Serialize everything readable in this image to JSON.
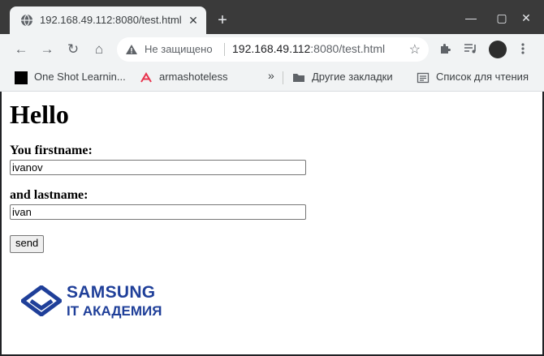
{
  "browser": {
    "tab": {
      "title": "192.168.49.112:8080/test.html",
      "favicon": "globe-icon",
      "close": "✕"
    },
    "new_tab": "+",
    "window_controls": [
      "—",
      "▢",
      "✕"
    ],
    "nav": {
      "back": "←",
      "forward": "→",
      "reload": "↻",
      "home": "⌂"
    },
    "omnibox": {
      "security_label": "Не защищено",
      "url_host": "192.168.49.112",
      "url_rest": ":8080/test.html"
    },
    "bookmarks": [
      {
        "label": "One Shot Learnin...",
        "icon": "black-square-icon"
      },
      {
        "label": "armashoteless",
        "icon": "red-arrow-icon"
      }
    ],
    "bookmarks_overflow": "»",
    "other_bookmarks": "Другие закладки",
    "reading_list": "Список для чтения",
    "colors": {
      "titlebar": "#3a3a3a",
      "toolbar": "#f1f3f4",
      "logo_blue": "#1f3f99"
    }
  },
  "page": {
    "heading": "Hello",
    "form": {
      "firstname_label": "You firstname:",
      "firstname_value": "ivanov",
      "lastname_label": "and lastname:",
      "lastname_value": "ivan",
      "submit_label": "send"
    },
    "logo": {
      "line1": "SAMSUNG",
      "line2": "IT АКАДЕМИЯ"
    }
  }
}
